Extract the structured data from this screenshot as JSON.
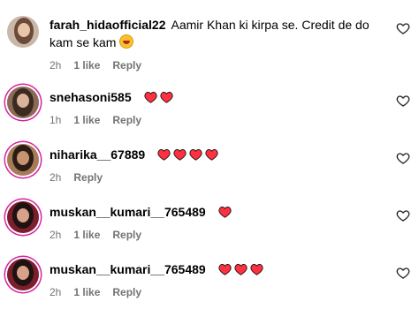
{
  "comments": [
    {
      "username": "farah_hidaofficial22",
      "text": "Aamir Khan ki kirpa se. Credit de do kam se kam",
      "emoji": "laughing-face",
      "hearts": 0,
      "time": "2h",
      "likes": "1 like",
      "reply": "Reply",
      "avatar_colors": [
        "#c9b7a8",
        "#6b4a3a",
        "#e8c4a8"
      ]
    },
    {
      "username": "snehasoni585",
      "text": "",
      "hearts": 2,
      "time": "1h",
      "likes": "1 like",
      "reply": "Reply",
      "avatar_colors": [
        "#8a6a55",
        "#3b2a22",
        "#d9b49a"
      ]
    },
    {
      "username": "niharika__67889",
      "text": "",
      "hearts": 4,
      "time": "2h",
      "likes": "",
      "reply": "Reply",
      "avatar_colors": [
        "#a87b58",
        "#2b1d16",
        "#c8946f"
      ]
    },
    {
      "username": "muskan__kumari__765489",
      "text": "",
      "hearts": 1,
      "time": "2h",
      "likes": "1 like",
      "reply": "Reply",
      "avatar_colors": [
        "#7a1f2b",
        "#1e1212",
        "#d7a18a"
      ]
    },
    {
      "username": "muskan__kumari__765489",
      "text": "",
      "hearts": 3,
      "time": "2h",
      "likes": "1 like",
      "reply": "Reply",
      "avatar_colors": [
        "#7a1f2b",
        "#1e1212",
        "#d7a18a"
      ]
    }
  ],
  "colors": {
    "heart": "#ff3040",
    "meta": "#737373",
    "story_ring": "#d6249f"
  },
  "icons": {
    "comment_like": "heart-outline-icon",
    "inline_heart": "red-heart-icon"
  }
}
